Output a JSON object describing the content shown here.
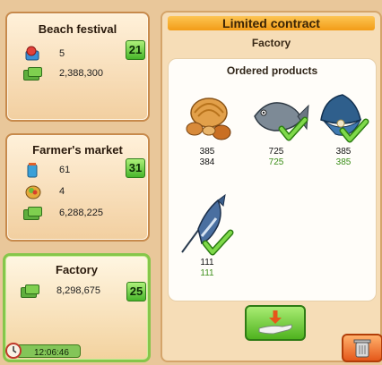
{
  "events": [
    {
      "title": "Beach festival",
      "count": "21",
      "rows": [
        {
          "icon": "tickets-icon",
          "value": "5"
        },
        {
          "icon": "money-icon",
          "value": "2,388,300"
        }
      ]
    },
    {
      "title": "Farmer's market",
      "count": "31",
      "rows": [
        {
          "icon": "jar-icon",
          "value": "61"
        },
        {
          "icon": "fruit-bag-icon",
          "value": "4"
        },
        {
          "icon": "money-icon",
          "value": "6,288,225"
        }
      ]
    },
    {
      "title": "Factory",
      "count": "25",
      "rows": [
        {
          "icon": "money-icon",
          "value": "8,298,675"
        }
      ]
    }
  ],
  "timer": {
    "value": "12:06:46",
    "icon": "clock-icon"
  },
  "contract": {
    "title": "Limited contract",
    "subtitle": "Factory",
    "products_title": "Ordered products",
    "products": [
      {
        "name": "shells",
        "icon": "shells-icon",
        "required": "385",
        "available": "384",
        "complete": false
      },
      {
        "name": "fish",
        "icon": "fish-icon",
        "required": "725",
        "available": "725",
        "complete": true
      },
      {
        "name": "clam",
        "icon": "clam-icon",
        "required": "385",
        "available": "385",
        "complete": true
      },
      {
        "name": "swordfish",
        "icon": "swordfish-icon",
        "required": "111",
        "available": "111",
        "complete": true
      }
    ],
    "deliver_icon": "deliver-hand-icon",
    "trash_icon": "trash-icon"
  },
  "colors": {
    "accent_green": "#4fb31f",
    "header_orange": "#f29c17",
    "complete_text": "#3c8f1a"
  }
}
